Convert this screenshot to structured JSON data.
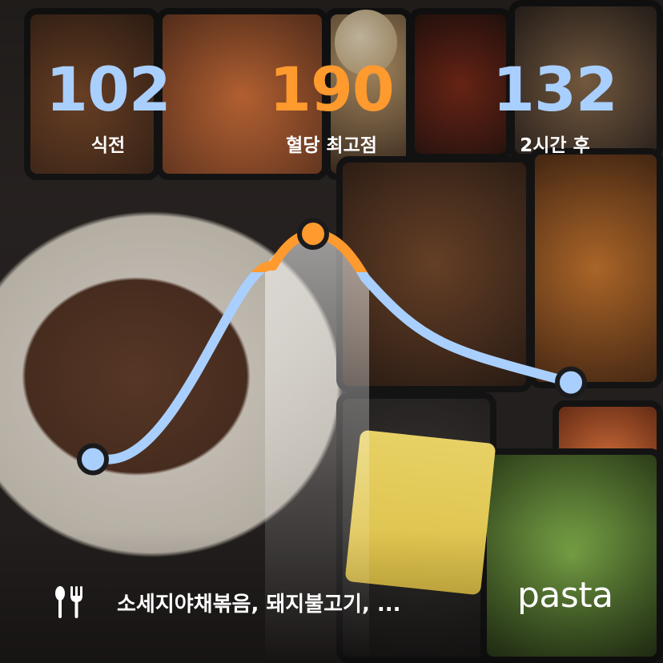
{
  "colors": {
    "normal": "#a9cfff",
    "peak": "#ff9a2e",
    "text": "#ffffff",
    "dot_outline": "#1b1b1d"
  },
  "stats": {
    "before": {
      "value": "102",
      "label": "식전",
      "color": "#a9cfff"
    },
    "peak": {
      "value": "190",
      "label": "혈당 최고점",
      "color": "#ff9a2e"
    },
    "after": {
      "value": "132",
      "label": "2시간 후",
      "color": "#a9cfff"
    }
  },
  "chart_data": {
    "type": "line",
    "series": [
      {
        "values": [
          102,
          190,
          132
        ]
      }
    ],
    "x": [
      "식전",
      "혈당 최고점",
      "2시간 후"
    ],
    "peak_threshold": 175
  },
  "footer": {
    "icon": "fork-knife-icon",
    "foods": "소세지야채볶음, 돼지불고기, ...",
    "brand": "pasta"
  }
}
